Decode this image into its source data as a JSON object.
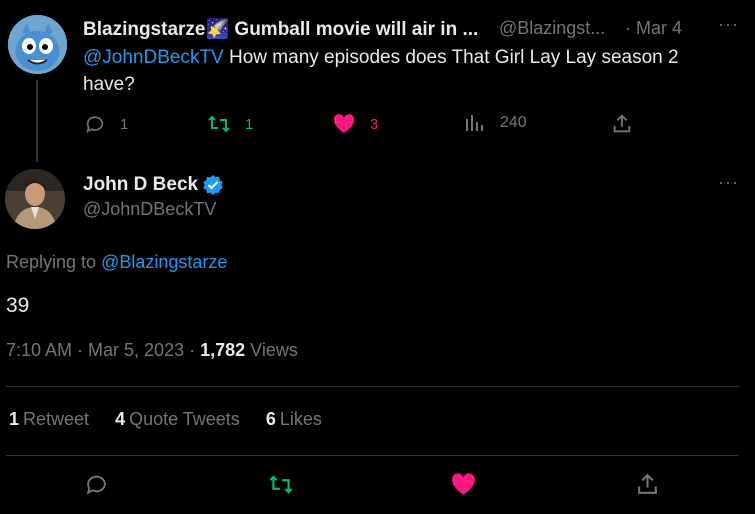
{
  "parent_tweet": {
    "name": "Blazingstarze🌠 Gumball movie will air in ...",
    "handle": "@Blazingst...",
    "date": "· Mar 4",
    "mention": "@JohnDBeckTV",
    "text": " How many episodes does That Girl Lay Lay season 2 have?",
    "replies": "1",
    "retweets": "1",
    "likes": "3",
    "views": "240",
    "colors": {
      "retweet": "#00ba7c",
      "like": "#f91880",
      "link": "#1d9bf0"
    }
  },
  "main_tweet": {
    "name": "John D Beck",
    "handle": "@JohnDBeckTV",
    "replying_prefix": "Replying to ",
    "replying_to": "@Blazingstarze",
    "text": "39",
    "time": "7:10 AM · Mar 5, 2023 · ",
    "views_count": "1,782",
    "views_label": " Views",
    "retweets_count": "1",
    "retweets_label": "Retweet",
    "quotes_count": "4",
    "quotes_label": "Quote Tweets",
    "likes_count": "6",
    "likes_label": "Likes",
    "verified_color": "#1d9bf0"
  },
  "more_label": "···"
}
